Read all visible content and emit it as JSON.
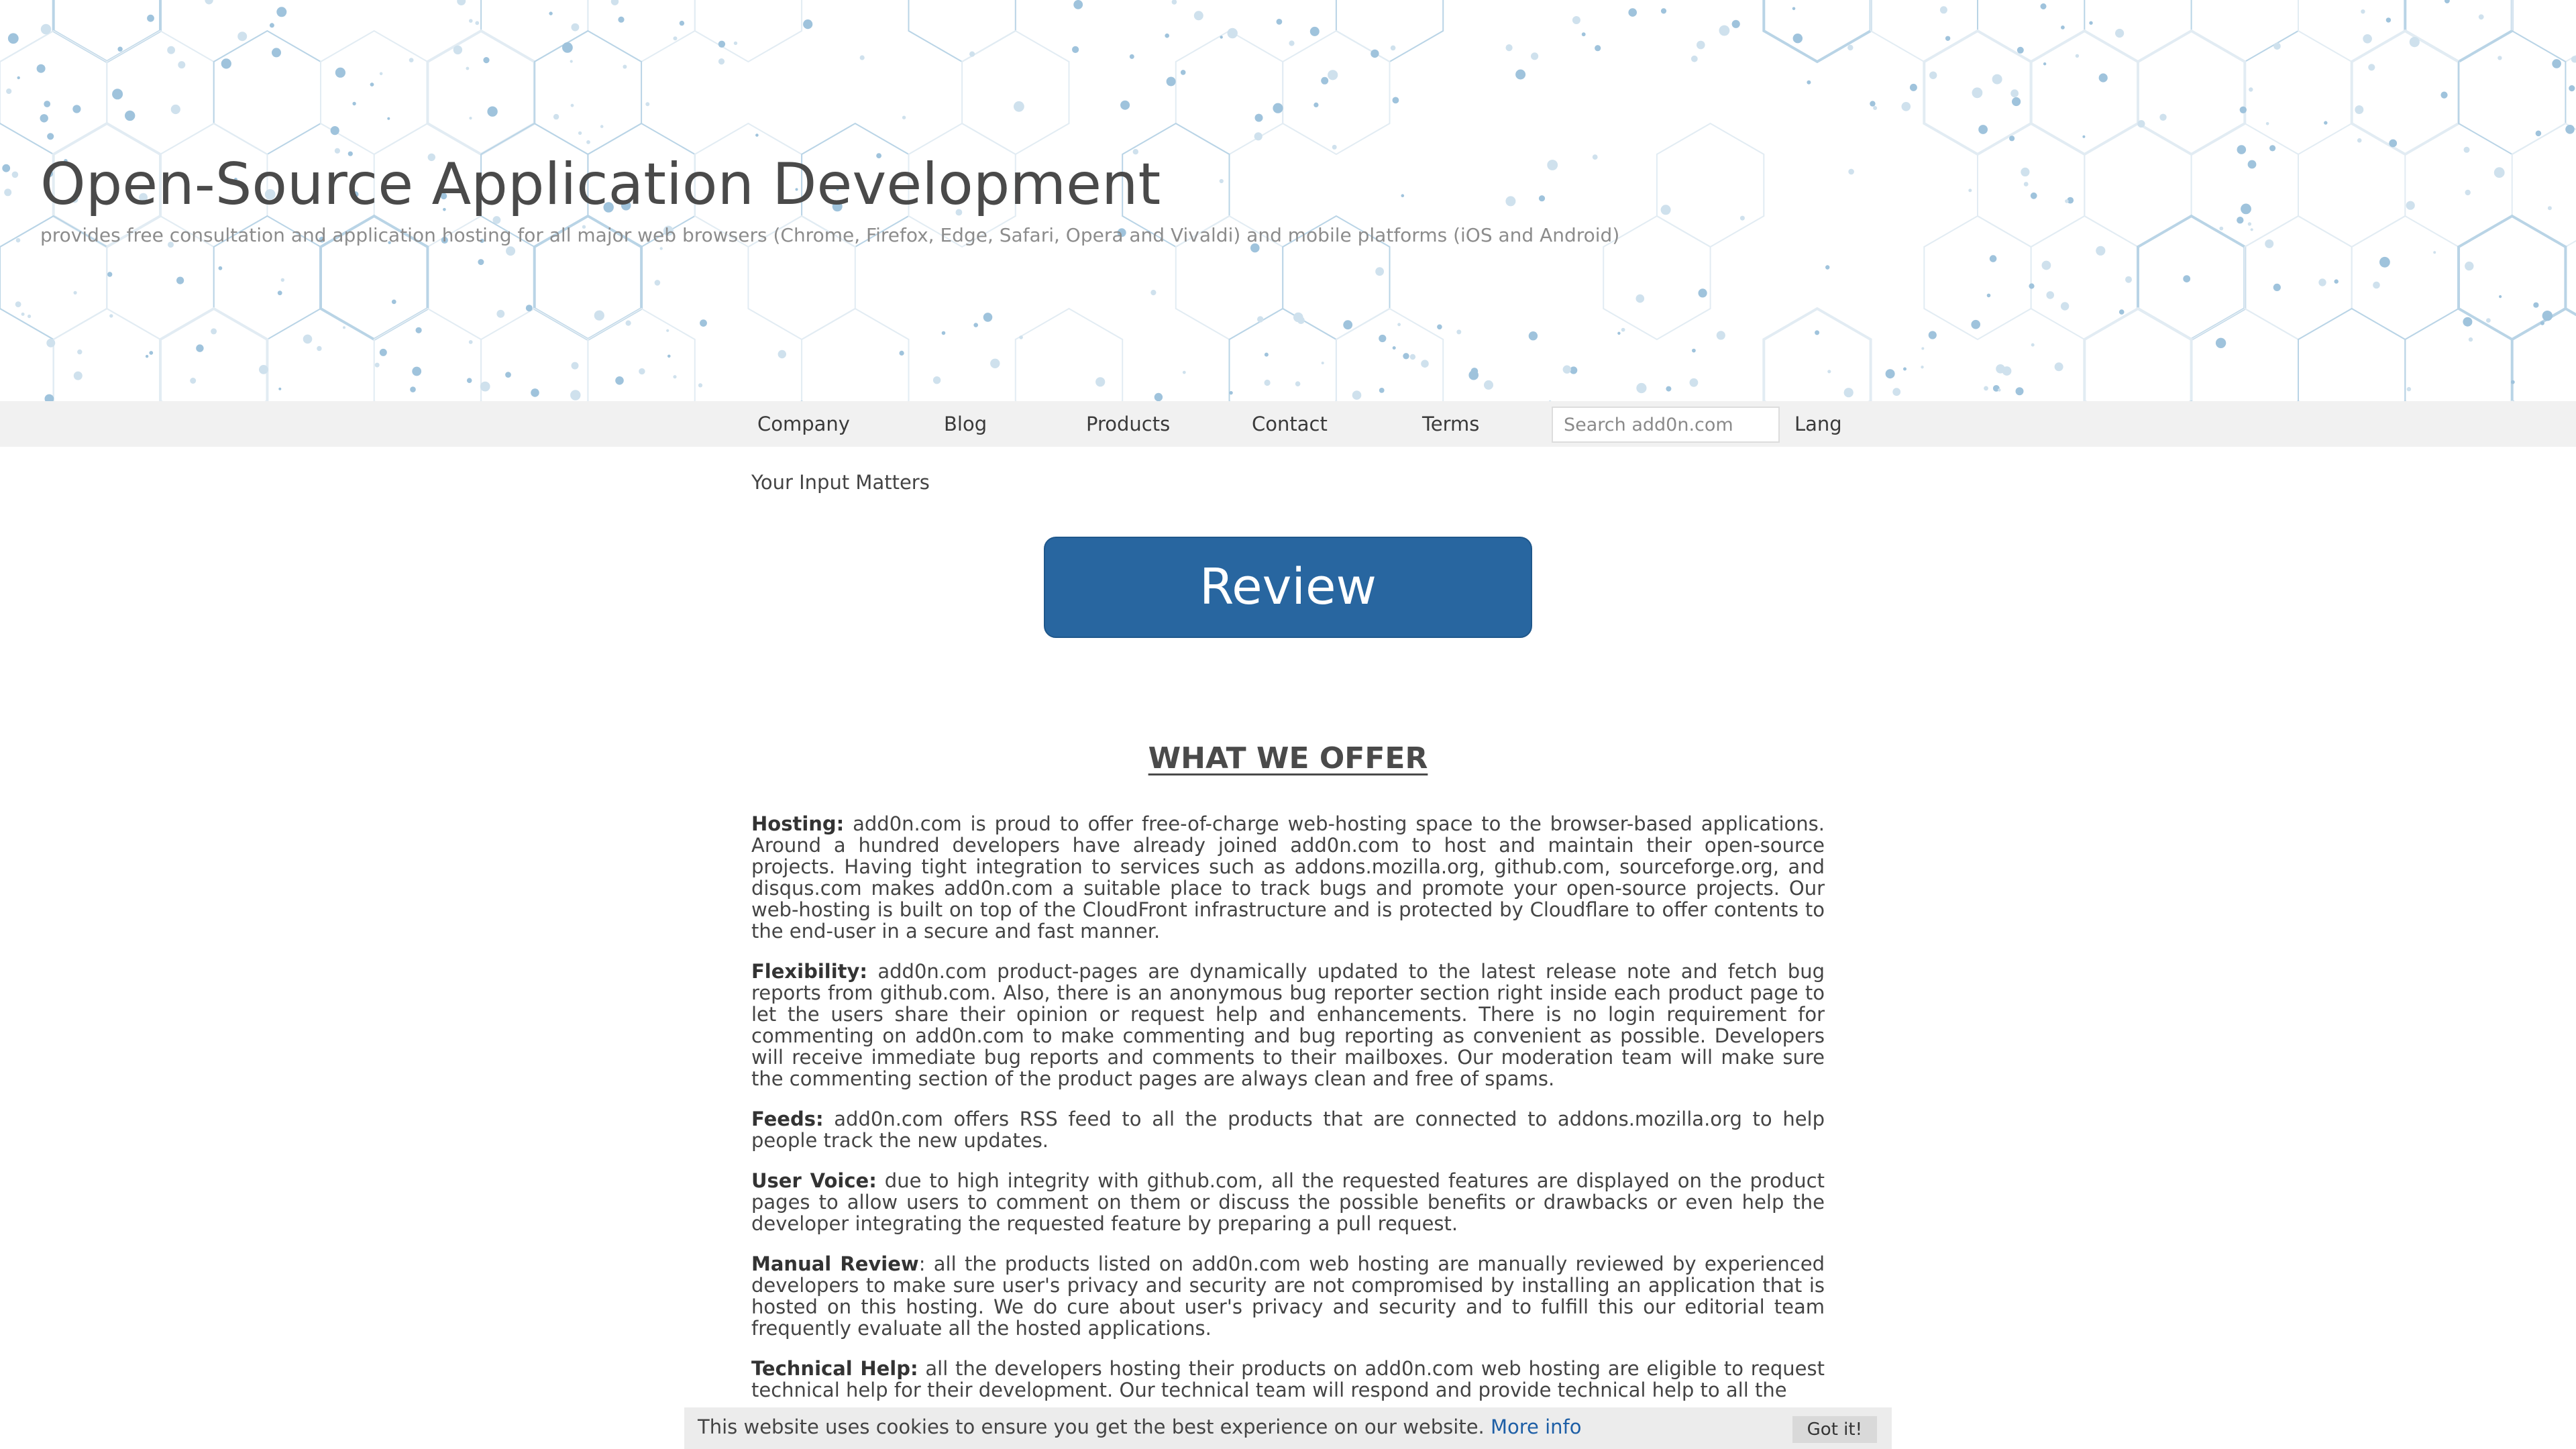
{
  "header": {
    "title": "Open-Source Application Development",
    "tagline": "provides free consultation and application hosting for all major web browsers (Chrome, Firefox, Edge, Safari, Opera and Vivaldi) and mobile platforms (iOS and Android)"
  },
  "nav": {
    "items": [
      "Company",
      "Blog",
      "Products",
      "Contact",
      "Terms"
    ],
    "search_placeholder": "Search add0n.com",
    "lang": "Lang"
  },
  "main": {
    "input_matters": "Your Input Matters",
    "review_button": "Review",
    "offer_heading": "WHAT WE OFFER",
    "sections": [
      {
        "title": "Hosting:",
        "text": "add0n.com is proud to offer free-of-charge web-hosting space to the browser-based applications. Around a hundred developers have already joined add0n.com to host and maintain their open-source projects. Having tight integration to services such as addons.mozilla.org, github.com, sourceforge.org, and disqus.com makes add0n.com a suitable place to track bugs and promote your open-source projects. Our web-hosting is built on top of the CloudFront infrastructure and is protected by Cloudflare to offer contents to the end-user in a secure and fast manner."
      },
      {
        "title": "Flexibility:",
        "text": "add0n.com product-pages are dynamically updated to the latest release note and fetch bug reports from github.com. Also, there is an anonymous bug reporter section right inside each product page to let the users share their opinion or request help and enhancements. There is no login requirement for commenting on add0n.com to make commenting and bug reporting as convenient as possible. Developers will receive immediate bug reports and comments to their mailboxes. Our moderation team will make sure the commenting section of the product pages are always clean and free of spams."
      },
      {
        "title": "Feeds:",
        "text": "add0n.com offers RSS feed to all the products that are connected to addons.mozilla.org to help people track the new updates."
      },
      {
        "title": "User Voice:",
        "text": "due to high integrity with github.com, all the requested features are displayed on the product pages to allow users to comment on them or discuss the possible benefits or drawbacks or even help the developer integrating the requested feature by preparing a pull request."
      },
      {
        "title": "Manual Review",
        "text": ": all the products listed on add0n.com web hosting are manually reviewed by experienced developers to make sure user's privacy and security are not compromised by installing an application that is hosted on this hosting. We do cure about user's privacy and security and to fulfill this our editorial team frequently evaluate all the hosted applications."
      },
      {
        "title": "Technical Help:",
        "text": "all the developers hosting their products on add0n.com web hosting are eligible to request technical help for their development. Our technical team will respond and provide technical help to all the"
      }
    ]
  },
  "cookie": {
    "text": "This website uses cookies to ensure you get the best experience on our website.",
    "more_info": "More info",
    "ok": "Got it!"
  }
}
